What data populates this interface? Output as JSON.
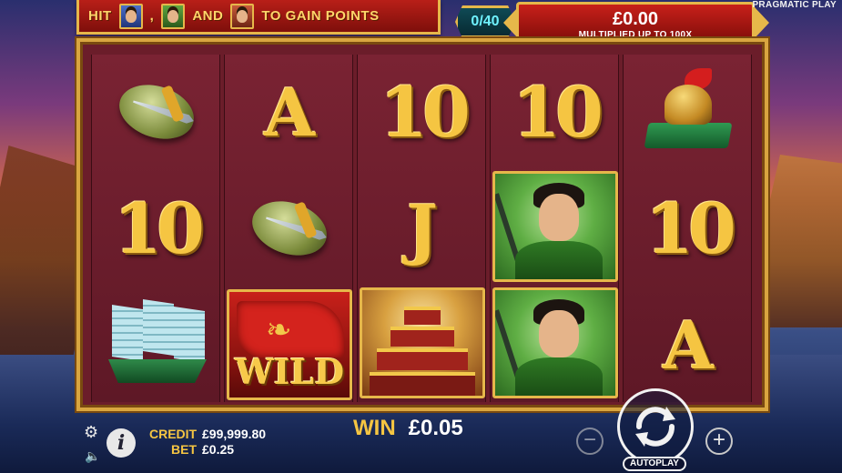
{
  "banner": {
    "hit": "HIT",
    "comma": ",",
    "and": "AND",
    "goal": "TO GAIN POINTS",
    "portraits": [
      "blue-warrior",
      "green-warrior",
      "red-warrior"
    ]
  },
  "counter": {
    "value": "0/40"
  },
  "win_panel": {
    "amount": "£0.00",
    "subtitle": "MULTIPLIED UP TO 100X"
  },
  "provider": "PRAGMATIC PLAY",
  "reels": [
    [
      "shield-sword",
      "10",
      "ship"
    ],
    [
      "A",
      "shield-sword",
      "wild"
    ],
    [
      "10",
      "J",
      "temple"
    ],
    [
      "10",
      "warrior",
      "warrior"
    ],
    [
      "helmet",
      "10",
      "A"
    ]
  ],
  "symbols": {
    "r0_1": "10",
    "r1_0": "A",
    "r2_0": "10",
    "r2_1": "J",
    "r3_0": "10",
    "r4_1": "10",
    "r4_2": "A",
    "wild": "WILD"
  },
  "status": {
    "credit_label": "CREDIT",
    "credit_value": "£99,999.80",
    "bet_label": "BET",
    "bet_value": "£0.25",
    "win_label": "WIN",
    "win_value": "£0.05"
  },
  "controls": {
    "minus": "−",
    "plus": "+",
    "autoplay": "AUTOPLAY",
    "info": "i"
  },
  "colors": {
    "gold": "#f5c542",
    "frame": "#d9a640",
    "reel_bg": "#6b1d2a",
    "red_panel": "#c8201a",
    "counter_text": "#6ff2ff"
  }
}
